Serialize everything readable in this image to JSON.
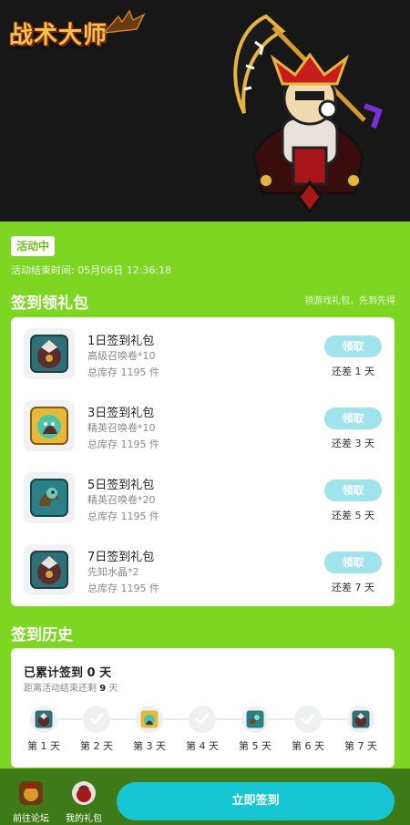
{
  "header": {
    "logo_text": "战术大师"
  },
  "activity": {
    "status_badge": "活动中",
    "end_time": "活动结束时间: 05月06日 12:36:18"
  },
  "gifts_section": {
    "title": "签到领礼包",
    "hint": "领游戏礼包，先到先得",
    "items": [
      {
        "name": "1日签到礼包",
        "item": "高级召唤卷*10",
        "stock": "总库存 1195 件",
        "button": "领取",
        "remain": "还差 1 天",
        "icon": "hero-bird-icon"
      },
      {
        "name": "3日签到礼包",
        "item": "精英召唤卷*10",
        "stock": "总库存 1195 件",
        "button": "领取",
        "remain": "还差 3 天",
        "icon": "hero-golden-icon"
      },
      {
        "name": "5日签到礼包",
        "item": "精英召唤卷*20",
        "stock": "总库存 1195 件",
        "button": "领取",
        "remain": "还差 5 天",
        "icon": "hero-dragon-icon"
      },
      {
        "name": "7日签到礼包",
        "item": "先知水晶*2",
        "stock": "总库存 1195 件",
        "button": "领取",
        "remain": "还差 7 天",
        "icon": "hero-bird-icon"
      }
    ]
  },
  "history": {
    "title": "签到历史",
    "total_prefix": "已累计签到",
    "total_days": "0",
    "total_unit": "天",
    "remain_prefix": "距离活动结束还剩",
    "remain_days": "9",
    "remain_unit": "天",
    "days": [
      {
        "label": "第 1 天",
        "icon": "hero-bird-icon"
      },
      {
        "label": "第 2 天",
        "icon": "check-icon"
      },
      {
        "label": "第 3 天",
        "icon": "hero-golden-icon"
      },
      {
        "label": "第 4 天",
        "icon": "check-icon"
      },
      {
        "label": "第 5 天",
        "icon": "hero-dragon-icon"
      },
      {
        "label": "第 6 天",
        "icon": "check-icon"
      },
      {
        "label": "第 7 天",
        "icon": "hero-bird-icon"
      }
    ]
  },
  "bottom_bar": {
    "forum_label": "前往论坛",
    "gifts_label": "我的礼包",
    "checkin_button": "立即签到"
  },
  "colors": {
    "page_bg": "#7dd622",
    "claim_button": "#9fe4ec",
    "checkin_button": "#17c6d3",
    "bottom_bar": "#3f7a18"
  }
}
